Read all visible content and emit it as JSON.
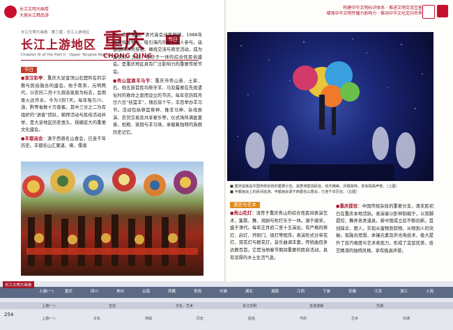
{
  "header": {
    "left_line1": "长江文明大画卷",
    "left_line2": "大美长江精品游",
    "right_line1": "构建中华文明标识体系 · 推进文明交流互鉴",
    "right_line2": "增强中华文明传播力影响力 · 推动中华文化走向世界"
  },
  "title": {
    "small": "长江文明大画卷 · 第三篇 · 长江上游地区",
    "main": "长江上游地区",
    "city": "重庆",
    "tag": "节日",
    "en": "Chapter III of the Part II · Upper Yangtze Region",
    "en_city": "CHONG QING"
  },
  "left_col1": {
    "tag": "节日",
    "p1_head": "●宣汉彩亭",
    "p1": "重庆大足宝顶山石窟所在的宗教与民俗融合的盛会。始于南宋，元明两代，以农历二月十九观音诞辰为标志，会期香火达月余，今为3到7天。每年吸引川、滇、黔等省数十万香客。其中三分之二为有组织的“进香”团队，朝拜活动与民俗活动并举，是大足地区历史悠久、规模宏大的重要文化盛会。",
    "p2_head": "●丰都庙会",
    "p2": "源于西晋名山香会，已连千年历史。丰都名山汇聚道、佛、儒诸"
  },
  "left_col2": {
    "p1": "中、青头善题。清代庙会达至巅峰，1988年民间恢复举办，吸引海内外数十万人参与。庙会期间神灵祭祀、傩戏交流与商贸活动，成为集信仰、文化、经济于一体的综合性民俗盛会。是重庆地区具有广泛影响力的重要传统节会。",
    "p2_head": "●秀山篮旗羊马节",
    "p2": "重庆市秀山苗、土家、石、侗五族首民均祭牙羊、马及露索在先祖遗址时的救命之恩而设立的节庆。每年农历四月廿六日“挂篮羊”，随后盲个午，丰目举办羊马节。活动包括祭篮祭神、推羊马神、杂戏表演、农贸交易及共享宴乐等，仪式场所满盈富善，祀殿、家园与羊马场，承载着独特的族群历史记忆。"
  },
  "right_caption": {
    "line1": "■ 重庆提炼是中国传统杂技的重要分支，其表演富饶民俗、欢乐精美、风格独特，享有极高声誉。（上图）",
    "line2": "■ 丰都庙会上的民间巡游，丰都庙会源于西晋名山香会，已连千年历史。（左图）"
  },
  "right_col1": {
    "tag": "游艺与艺术",
    "p1_head": "●秀山花灯",
    "p1": "流传于重庆秀山的综合性民间表演艺术，集歌、舞、戏剧与吹打乐于一体。源于唐宋，盛于清代。每年正月初二至十五演出，有严格的祭灯、启灯、开耐门、烧灯等程序。表演形式分单花灯、双花灯与群花灯，音乐曲调丰富，传统曲目多达数百首。它是当地春节期间重要的民俗活动，具有浓厚的乡土生活气息。"
  },
  "right_col2": {
    "p1_head": "●重庆提技",
    "p1": "中国传统杂技的重要分支，清末民初已在重庆本地活跃。表演者以卧伸制缩于，以双脚提控、舞弄各类道具，新中国成立后不断创新，首创踩伞、蹬人，实现从蛋物到软物、从物到人的突破。现融合思想、体操元素及声光电技术，极大提升了技巧难度与艺术表现力，形成了造型优美、技艺精湛的独特风格，享有极高声誉。"
  },
  "timeline": {
    "left_label": "长江文明大画卷",
    "page_number": "254",
    "items": [
      "上游(一)",
      "重庆",
      "四川",
      "贵州",
      "云南",
      "西藏",
      "青海",
      "中游",
      "湖北",
      "湖南",
      "江西",
      "下游",
      "安徽",
      "江苏",
      "浙江",
      "上海"
    ],
    "sub": [
      "上游(一)",
      "玉龙",
      "文化、艺术",
      "长江文明",
      "支流流域",
      "交通"
    ],
    "bottom": [
      "上游(一)",
      "文化",
      "地域",
      "历史",
      "民俗",
      "节庆",
      "艺术",
      "交通"
    ]
  }
}
